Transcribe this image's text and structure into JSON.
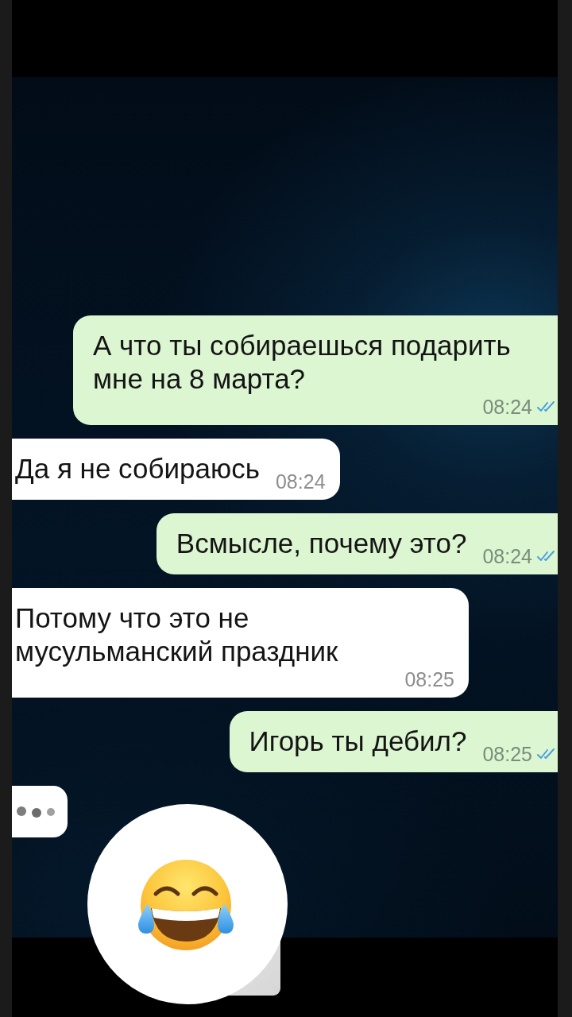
{
  "messages": [
    {
      "kind": "outgoing",
      "text": "А что ты собираешься подарить мне на 8 марта?",
      "time": "08:24",
      "read": true
    },
    {
      "kind": "incoming",
      "text": "Да я не собираюсь",
      "time": "08:24"
    },
    {
      "kind": "outgoing",
      "text": "Всмысле, почему это?",
      "time": "08:24",
      "read": true
    },
    {
      "kind": "incoming",
      "text": "Потому что это не мусульманский праздник",
      "time": "08:25"
    },
    {
      "kind": "outgoing",
      "text": "Игорь ты дебил?",
      "time": "08:25",
      "read": true
    }
  ],
  "typing": true
}
